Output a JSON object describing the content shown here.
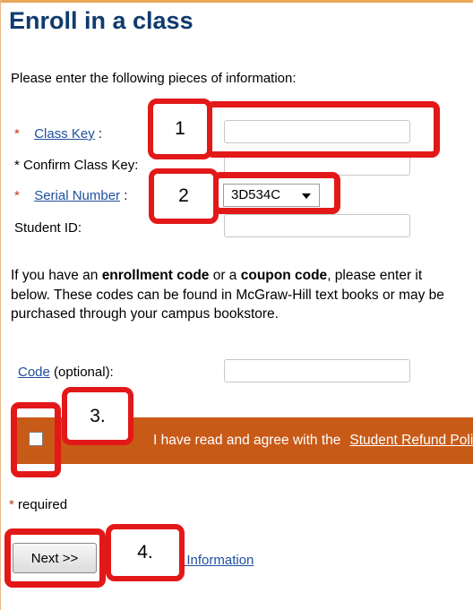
{
  "title": "Enroll in a class",
  "intro": "Please enter the following pieces of information:",
  "fields": {
    "required_star": "*",
    "class_key_label": "Class Key",
    "class_key_suffix": ":",
    "confirm_class_key_label": "* Confirm Class Key:",
    "serial_number_label": "Serial Number",
    "serial_number_suffix": ":",
    "serial_number_value": "3D534C",
    "student_id_label": "Student ID:"
  },
  "paragraph": {
    "part1": "If you have an ",
    "bold1": "enrollment code",
    "part2": " or a ",
    "bold2": "coupon code",
    "part3": ", please enter it below. These codes can be found in McGraw-Hill text books or may be purchased through your campus bookstore."
  },
  "code": {
    "link": "Code",
    "optional": " (optional):"
  },
  "agreement": {
    "text": "I have read and agree with the",
    "link": "Student Refund Policy",
    "tail": " ."
  },
  "required_note": {
    "star": "*",
    "text": " required"
  },
  "buttons": {
    "next": "Next >>"
  },
  "account_link": "Account Information",
  "callouts": [
    "1",
    "2",
    "3.",
    "4."
  ],
  "colors": {
    "title": "#0f3b6e",
    "link": "#1f4e9e",
    "agreement_bar": "#c85a18",
    "annotation_red": "#e31818"
  }
}
